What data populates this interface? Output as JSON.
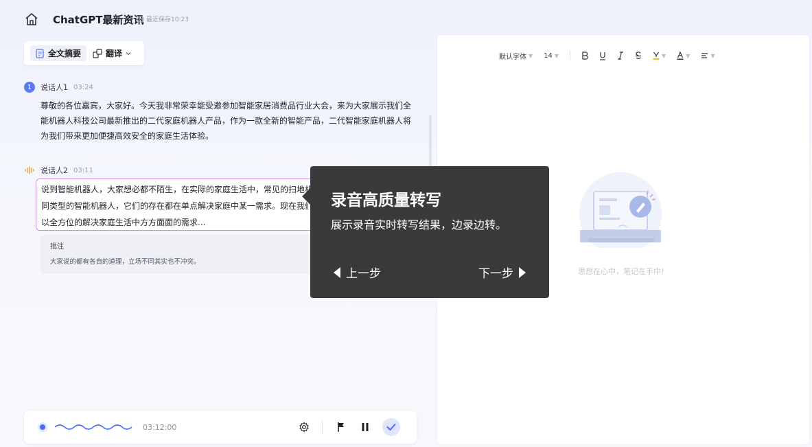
{
  "header": {
    "title": "ChatGPT最新资讯",
    "saved_text": "最近保存10:23"
  },
  "left_toolbar": {
    "summary_label": "全文摘要",
    "translate_label": "翻译"
  },
  "transcript": [
    {
      "index": "1",
      "speaker": "说话人1",
      "time": "03:24",
      "text": "尊敬的各位嘉宾，大家好。今天我非常荣幸能受邀参加智能家居消费品行业大会，来为大家展示我们全能机器人科技公司最新推出的二代家庭机器人产品，作为一款全新的智能产品，二代智能家庭机器人将为我们带来更加便捷高效安全的家庭生活体验。"
    },
    {
      "speaker": "说话人2",
      "time": "03:11",
      "text": "说到智能机器人，大家想必都不陌生，在实际的家庭生活中，常见的扫地机器人、儿童陪伴机器人等不同类型的智能机器人，它们的存在都在单点解决家庭中某一需求。现在我们推出的二代家庭机器人，可以全方位的解决家庭生活中方方面面的需求...",
      "note_title": "批注",
      "note_text": "大家说的都有各自的道理，立场不同其实也不冲突。"
    }
  ],
  "player": {
    "time": "03:12:00"
  },
  "editor": {
    "font_label": "默认字体",
    "size_label": "14",
    "empty_text": "思想在心中，笔记在手中！"
  },
  "tour": {
    "title": "录音高质量转写",
    "description": "展示录音实时转写结果，边录边转。",
    "prev_label": "上一步",
    "next_label": "下一步"
  },
  "colors": {
    "accent": "#4b6cf5",
    "highlight_border": "#c58ce8",
    "tour_bg": "#3a3a3a"
  }
}
